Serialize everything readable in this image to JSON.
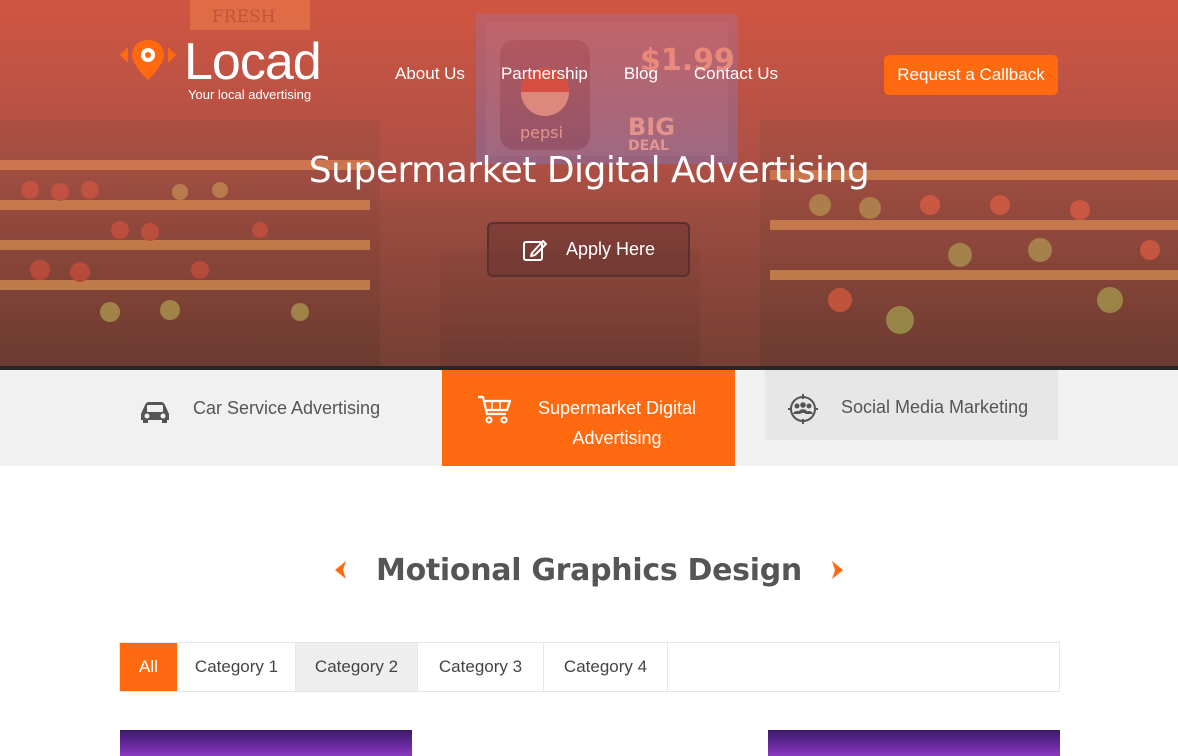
{
  "header": {
    "logo_word": "Locad",
    "logo_tagline": "Your local advertising",
    "nav": [
      "About Us",
      "Partnership",
      "Blog",
      "Contact Us"
    ],
    "callback_label": "Request a Callback"
  },
  "hero": {
    "title": "Supermarket Digital Advertising",
    "apply_label": "Apply Here"
  },
  "services": {
    "car": "Car Service Advertising",
    "supermarket": "Supermarket Digital Advertising",
    "social": "Social Media Marketing"
  },
  "section": {
    "title": "Motional Graphics Design"
  },
  "filters": [
    "All",
    "Category 1",
    "Category 2",
    "Category 3",
    "Category 4"
  ],
  "colors": {
    "accent": "#ff6a10",
    "text": "#555555",
    "band": "#f1f1f1"
  }
}
